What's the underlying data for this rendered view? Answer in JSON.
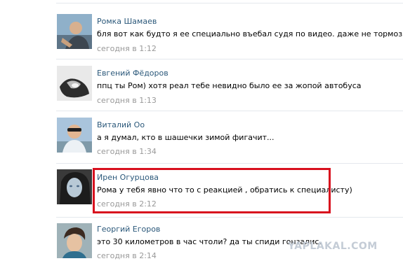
{
  "comments": [
    {
      "author": "Ромка Шамаев",
      "text": "бля вот как будто я ее специально въебал судя по видео. даже не тормозил",
      "time": "сегодня в 1:12",
      "avatar_icon": "user-photo-icon"
    },
    {
      "author": "Евгений Фёдоров",
      "text": "ппц ты Ром) хотя реал тебе невидно было ее за жопой автобуса",
      "time": "сегодня в 1:13",
      "avatar_icon": "user-photo-icon"
    },
    {
      "author": "Виталий Оо",
      "text": "а я думал, кто в шашечки зимой фигачит...",
      "time": "сегодня в 1:34",
      "avatar_icon": "user-photo-icon"
    },
    {
      "author": "Ирен Огурцова",
      "text": "Рома у тебя явно что то с реакцией , обратись к специалисту)",
      "time": "сегодня в 2:12",
      "avatar_icon": "user-photo-icon",
      "highlighted": true
    },
    {
      "author": "Георгий Егоров",
      "text": "это 30 километров в час чтоли? да ты спиди гонзалис.",
      "time": "сегодня в 2:14",
      "avatar_icon": "user-photo-icon"
    }
  ],
  "watermark": "YAPLAKAL.COM",
  "colors": {
    "author_link": "#2b587a",
    "timestamp": "#999999",
    "highlight_border": "#d8101e",
    "divider": "#e4e8ed"
  }
}
